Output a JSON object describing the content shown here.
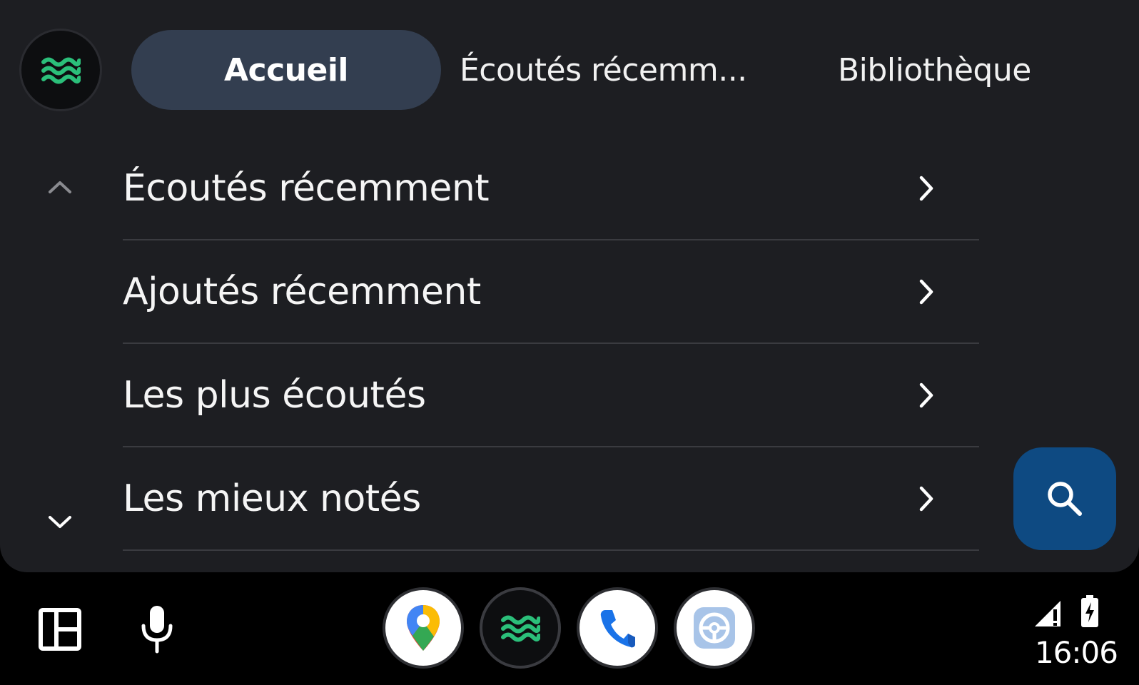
{
  "app": {
    "logo_icon": "waves-icon",
    "accent_color": "#2bbf7a"
  },
  "tabs": [
    {
      "label": "Accueil",
      "active": true
    },
    {
      "label": "Écoutés récemm..."
    },
    {
      "label": "Bibliothèque"
    }
  ],
  "list": {
    "items": [
      {
        "label": "Écoutés récemment"
      },
      {
        "label": "Ajoutés récemment"
      },
      {
        "label": "Les plus écoutés"
      },
      {
        "label": "Les mieux notés"
      }
    ]
  },
  "search": {
    "icon": "search-icon",
    "color": "#0e4a82"
  },
  "bottom_bar": {
    "dock": [
      {
        "name": "maps",
        "icon": "maps-pin-icon"
      },
      {
        "name": "music",
        "icon": "waves-icon"
      },
      {
        "name": "phone",
        "icon": "phone-icon"
      },
      {
        "name": "settings",
        "icon": "steering-settings-icon"
      }
    ],
    "status": {
      "time": "16:06"
    }
  }
}
